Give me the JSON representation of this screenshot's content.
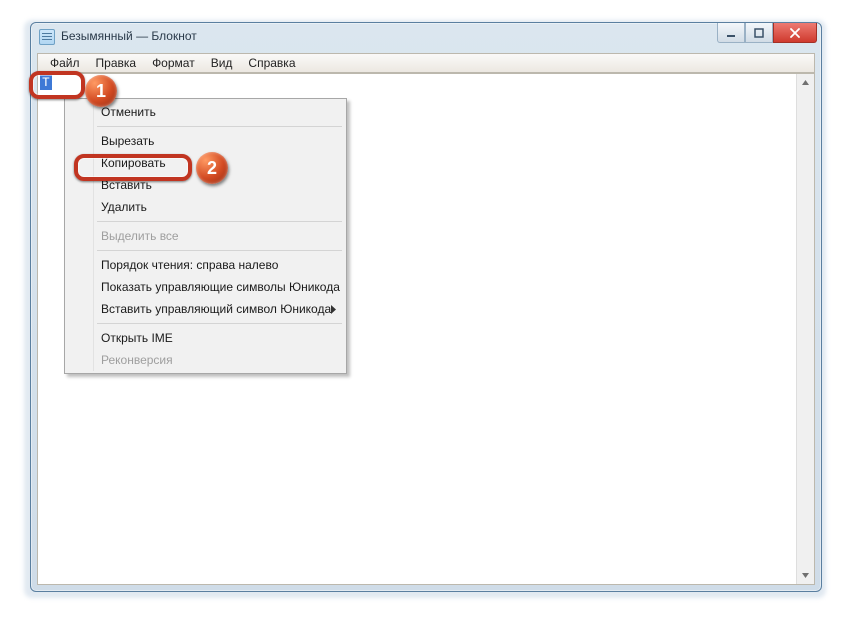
{
  "window": {
    "title": "Безымянный — Блокнот",
    "menu": {
      "file": "Файл",
      "edit": "Правка",
      "format": "Формат",
      "view": "Вид",
      "help": "Справка"
    },
    "selected_text": "T"
  },
  "context_menu": {
    "undo": "Отменить",
    "cut": "Вырезать",
    "copy": "Копировать",
    "paste": "Вставить",
    "delete": "Удалить",
    "select_all": "Выделить все",
    "reading_order": "Порядок чтения: справа налево",
    "show_unicode": "Показать управляющие символы Юникода",
    "insert_unicode": "Вставить управляющий символ Юникода",
    "open_ime": "Открыть IME",
    "reconversion": "Реконверсия"
  },
  "annotations": {
    "badge1": "1",
    "badge2": "2"
  }
}
